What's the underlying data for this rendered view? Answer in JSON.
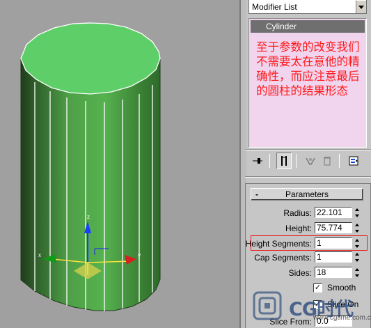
{
  "modifier_list": {
    "label": "Modifier List"
  },
  "stack": {
    "item": "Cylinder",
    "note": "至于参数的改变我们不需要太在意他的精确性，而应注意最后的圆柱的结果形态"
  },
  "toolbar": {
    "icons": [
      "pin-stack-icon",
      "show-end-result-icon",
      "make-unique-icon",
      "remove-modifier-icon",
      "configure-modifier-sets-icon"
    ]
  },
  "parameters": {
    "title": "Parameters",
    "collapse": "-",
    "fields": [
      {
        "label": "Radius:",
        "value": "22.101"
      },
      {
        "label": "Height:",
        "value": "75.774"
      },
      {
        "label": "Height Segments:",
        "value": "1"
      },
      {
        "label": "Cap Segments:",
        "value": "1"
      },
      {
        "label": "Sides:",
        "value": "18"
      }
    ],
    "smooth": {
      "label": "Smooth",
      "checked": true
    },
    "slice_on": {
      "label": "Slice On",
      "checked": true
    },
    "slice_from": {
      "label": "Slice From:",
      "value": "0.0"
    }
  },
  "watermark": {
    "brand": "CG时代",
    "url": "www.cgtime.com.cn"
  },
  "colors": {
    "cylinder_top": "#5ecf68",
    "cylinder_side": "#4fae4a",
    "viewport_bg": "#a0a0a0",
    "note_text": "#ff1a1a",
    "stack_bg": "#f1d4ee",
    "highlight_box": "#e81818"
  }
}
